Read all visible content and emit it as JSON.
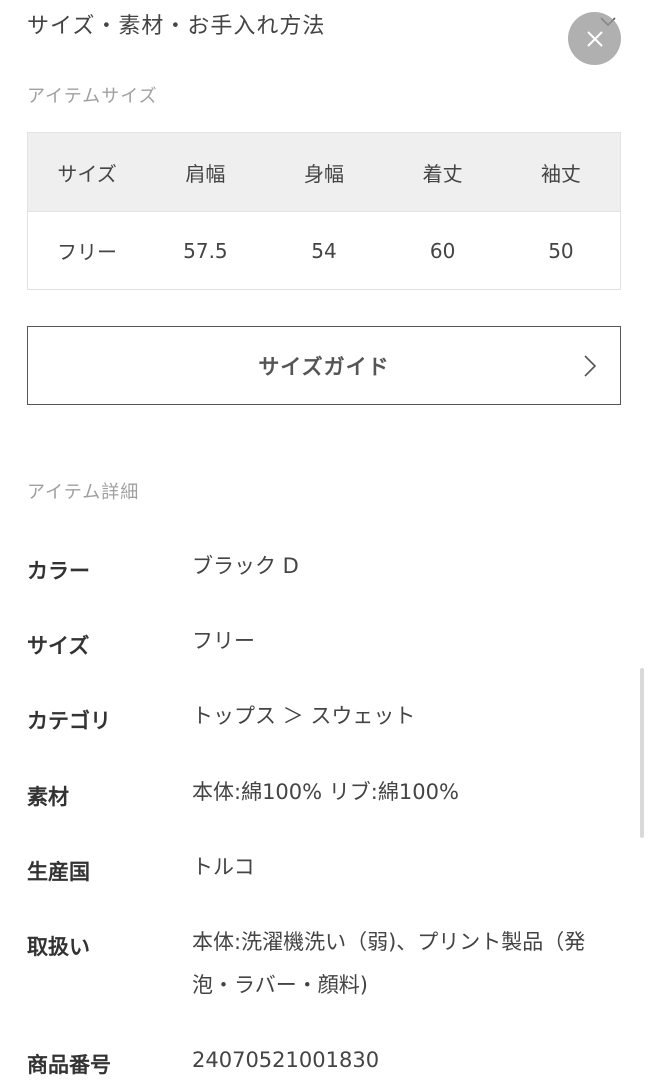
{
  "header": {
    "title": "サイズ・素材・お手入れ方法"
  },
  "item_size": {
    "section_label": "アイテムサイズ",
    "columns": [
      "サイズ",
      "肩幅",
      "身幅",
      "着丈",
      "袖丈"
    ],
    "rows": [
      [
        "フリー",
        "57.5",
        "54",
        "60",
        "50"
      ]
    ]
  },
  "size_guide": {
    "label": "サイズガイド"
  },
  "item_detail": {
    "section_label": "アイテム詳細",
    "rows": [
      {
        "key": "カラー",
        "value": "ブラック D"
      },
      {
        "key": "サイズ",
        "value": "フリー"
      },
      {
        "key": "カテゴリ",
        "value": "トップス ＞ スウェット"
      },
      {
        "key": "素材",
        "value": "本体:綿100% リブ:綿100%"
      },
      {
        "key": "生産国",
        "value": "トルコ"
      },
      {
        "key": "取扱い",
        "value": "本体:洗濯機洗い（弱)、プリント製品（発泡・ラバー・顔料)"
      },
      {
        "key": "商品番号",
        "value": "24070521001830"
      }
    ]
  },
  "icons": {
    "close": "close-icon",
    "collapse": "chevron-down-icon",
    "guide_arrow": "chevron-right-icon"
  }
}
